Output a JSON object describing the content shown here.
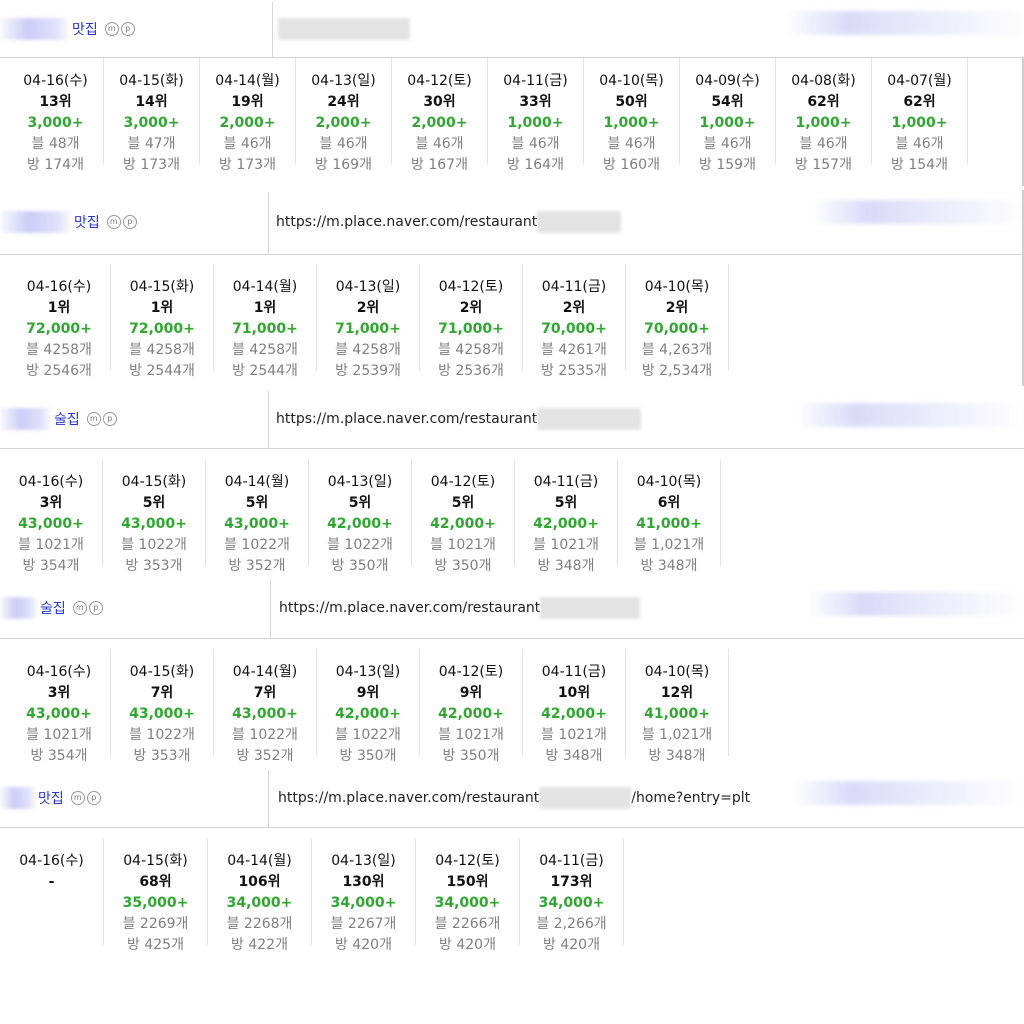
{
  "blocks": [
    {
      "keyword": "맛집",
      "badges": [
        "ⓜ",
        "ⓟ"
      ],
      "url_prefix": "",
      "url_suffix": "",
      "days": [
        {
          "date": "04-16(수)",
          "rank": "13위",
          "score": "3,000+",
          "blog": "블 48개",
          "room": "방 174개"
        },
        {
          "date": "04-15(화)",
          "rank": "14위",
          "score": "3,000+",
          "blog": "블 47개",
          "room": "방 173개"
        },
        {
          "date": "04-14(월)",
          "rank": "19위",
          "score": "2,000+",
          "blog": "블 46개",
          "room": "방 173개"
        },
        {
          "date": "04-13(일)",
          "rank": "24위",
          "score": "2,000+",
          "blog": "블 46개",
          "room": "방 169개"
        },
        {
          "date": "04-12(토)",
          "rank": "30위",
          "score": "2,000+",
          "blog": "블 46개",
          "room": "방 167개"
        },
        {
          "date": "04-11(금)",
          "rank": "33위",
          "score": "1,000+",
          "blog": "블 46개",
          "room": "방 164개"
        },
        {
          "date": "04-10(목)",
          "rank": "50위",
          "score": "1,000+",
          "blog": "블 46개",
          "room": "방 160개"
        },
        {
          "date": "04-09(수)",
          "rank": "54위",
          "score": "1,000+",
          "blog": "블 46개",
          "room": "방 159개"
        },
        {
          "date": "04-08(화)",
          "rank": "62위",
          "score": "1,000+",
          "blog": "블 46개",
          "room": "방 157개"
        },
        {
          "date": "04-07(월)",
          "rank": "62위",
          "score": "1,000+",
          "blog": "블 46개",
          "room": "방 154개"
        }
      ]
    },
    {
      "keyword": "맛집",
      "badges": [
        "ⓜ",
        "ⓟ"
      ],
      "url_prefix": "https://m.place.naver.com/restaurant",
      "url_suffix": "",
      "days": [
        {
          "date": "04-16(수)",
          "rank": "1위",
          "score": "72,000+",
          "blog": "블 4258개",
          "room": "방 2546개"
        },
        {
          "date": "04-15(화)",
          "rank": "1위",
          "score": "72,000+",
          "blog": "블 4258개",
          "room": "방 2544개"
        },
        {
          "date": "04-14(월)",
          "rank": "1위",
          "score": "71,000+",
          "blog": "블 4258개",
          "room": "방 2544개"
        },
        {
          "date": "04-13(일)",
          "rank": "2위",
          "score": "71,000+",
          "blog": "블 4258개",
          "room": "방 2539개"
        },
        {
          "date": "04-12(토)",
          "rank": "2위",
          "score": "71,000+",
          "blog": "블 4258개",
          "room": "방 2536개"
        },
        {
          "date": "04-11(금)",
          "rank": "2위",
          "score": "70,000+",
          "blog": "블 4261개",
          "room": "방 2535개"
        },
        {
          "date": "04-10(목)",
          "rank": "2위",
          "score": "70,000+",
          "blog": "블 4,263개",
          "room": "방 2,534개"
        }
      ]
    },
    {
      "keyword": "술집",
      "badges": [
        "ⓜ",
        "ⓟ"
      ],
      "url_prefix": "https://m.place.naver.com/restaurant",
      "url_suffix": "",
      "days": [
        {
          "date": "04-16(수)",
          "rank": "3위",
          "score": "43,000+",
          "blog": "블 1021개",
          "room": "방 354개"
        },
        {
          "date": "04-15(화)",
          "rank": "5위",
          "score": "43,000+",
          "blog": "블 1022개",
          "room": "방 353개"
        },
        {
          "date": "04-14(월)",
          "rank": "5위",
          "score": "43,000+",
          "blog": "블 1022개",
          "room": "방 352개"
        },
        {
          "date": "04-13(일)",
          "rank": "5위",
          "score": "42,000+",
          "blog": "블 1022개",
          "room": "방 350개"
        },
        {
          "date": "04-12(토)",
          "rank": "5위",
          "score": "42,000+",
          "blog": "블 1021개",
          "room": "방 350개"
        },
        {
          "date": "04-11(금)",
          "rank": "5위",
          "score": "42,000+",
          "blog": "블 1021개",
          "room": "방 348개"
        },
        {
          "date": "04-10(목)",
          "rank": "6위",
          "score": "41,000+",
          "blog": "블 1,021개",
          "room": "방 348개"
        }
      ]
    },
    {
      "keyword": "술집",
      "badges": [
        "ⓜ",
        "ⓟ"
      ],
      "url_prefix": "https://m.place.naver.com/restaurant",
      "url_suffix": "",
      "days": [
        {
          "date": "04-16(수)",
          "rank": "3위",
          "score": "43,000+",
          "blog": "블 1021개",
          "room": "방 354개"
        },
        {
          "date": "04-15(화)",
          "rank": "7위",
          "score": "43,000+",
          "blog": "블 1022개",
          "room": "방 353개"
        },
        {
          "date": "04-14(월)",
          "rank": "7위",
          "score": "43,000+",
          "blog": "블 1022개",
          "room": "방 352개"
        },
        {
          "date": "04-13(일)",
          "rank": "9위",
          "score": "42,000+",
          "blog": "블 1022개",
          "room": "방 350개"
        },
        {
          "date": "04-12(토)",
          "rank": "9위",
          "score": "42,000+",
          "blog": "블 1021개",
          "room": "방 350개"
        },
        {
          "date": "04-11(금)",
          "rank": "10위",
          "score": "42,000+",
          "blog": "블 1021개",
          "room": "방 348개"
        },
        {
          "date": "04-10(목)",
          "rank": "12위",
          "score": "41,000+",
          "blog": "블 1,021개",
          "room": "방 348개"
        }
      ]
    },
    {
      "keyword": "맛집",
      "badges": [
        "ⓜ",
        "ⓟ"
      ],
      "url_prefix": "https://m.place.naver.com/restaurant",
      "url_suffix": "/home?entry=plt",
      "days": [
        {
          "date": "04-16(수)",
          "rank": "-",
          "score": "",
          "blog": "",
          "room": ""
        },
        {
          "date": "04-15(화)",
          "rank": "68위",
          "score": "35,000+",
          "blog": "블 2269개",
          "room": "방 425개"
        },
        {
          "date": "04-14(월)",
          "rank": "106위",
          "score": "34,000+",
          "blog": "블 2268개",
          "room": "방 422개"
        },
        {
          "date": "04-13(일)",
          "rank": "130위",
          "score": "34,000+",
          "blog": "블 2267개",
          "room": "방 420개"
        },
        {
          "date": "04-12(토)",
          "rank": "150위",
          "score": "34,000+",
          "blog": "블 2266개",
          "room": "방 420개"
        },
        {
          "date": "04-11(금)",
          "rank": "173위",
          "score": "34,000+",
          "blog": "블 2,266개",
          "room": "방 420개"
        }
      ]
    }
  ]
}
